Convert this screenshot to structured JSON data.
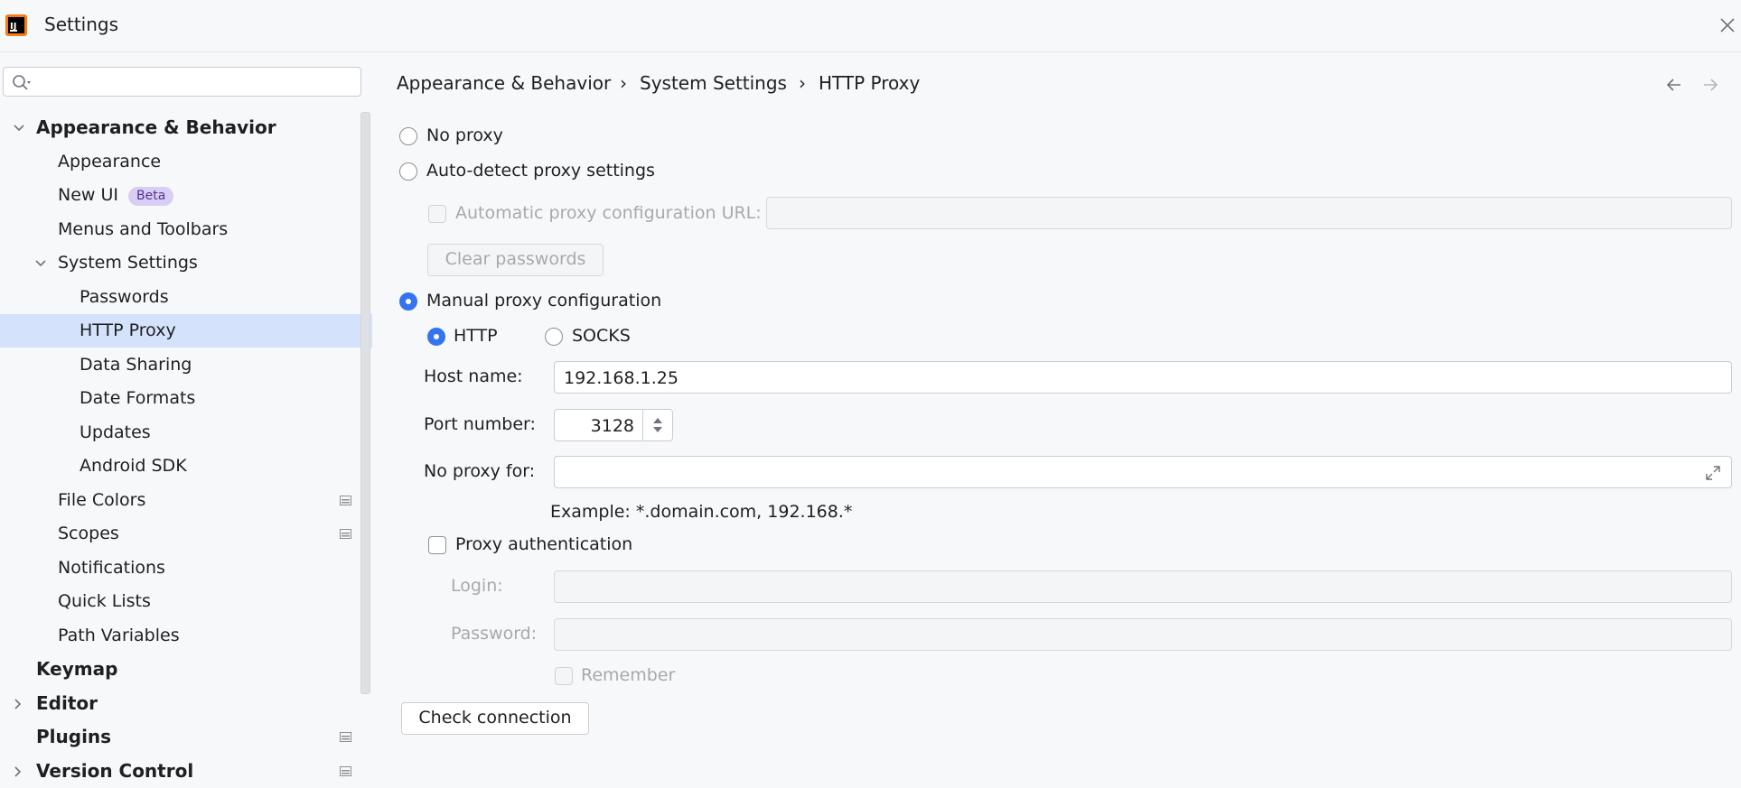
{
  "window": {
    "title": "Settings",
    "app_icon": "intellij-app-icon",
    "close_icon": "close-icon"
  },
  "search": {
    "placeholder": "",
    "value": ""
  },
  "sidebar": {
    "items": [
      {
        "label": "Appearance & Behavior",
        "expanded": true
      },
      {
        "label": "Appearance"
      },
      {
        "label": "New UI",
        "badge": "Beta"
      },
      {
        "label": "Menus and Toolbars"
      },
      {
        "label": "System Settings",
        "expanded": true
      },
      {
        "label": "Passwords"
      },
      {
        "label": "HTTP Proxy",
        "selected": true
      },
      {
        "label": "Data Sharing"
      },
      {
        "label": "Date Formats"
      },
      {
        "label": "Updates"
      },
      {
        "label": "Android SDK"
      },
      {
        "label": "File Colors",
        "project_level": true
      },
      {
        "label": "Scopes",
        "project_level": true
      },
      {
        "label": "Notifications"
      },
      {
        "label": "Quick Lists"
      },
      {
        "label": "Path Variables"
      },
      {
        "label": "Keymap"
      },
      {
        "label": "Editor",
        "expanded": false
      },
      {
        "label": "Plugins",
        "project_level": true
      },
      {
        "label": "Version Control",
        "expanded": false,
        "project_level": true
      }
    ]
  },
  "breadcrumb": [
    "Appearance & Behavior",
    "System Settings",
    "HTTP Proxy"
  ],
  "breadcrumb_separator": "›",
  "proxy": {
    "no_proxy_label": "No proxy",
    "auto_detect_label": "Auto-detect proxy settings",
    "auto_config_url_label": "Automatic proxy configuration URL:",
    "auto_config_url_value": "",
    "clear_passwords_label": "Clear passwords",
    "manual_label": "Manual proxy configuration",
    "selected_mode": "Manual proxy configuration",
    "http_label": "HTTP",
    "socks_label": "SOCKS",
    "selected_protocol": "HTTP",
    "host_label": "Host name:",
    "host_value": "192.168.1.25",
    "port_label": "Port number:",
    "port_value": "3128",
    "no_proxy_for_label": "No proxy for:",
    "no_proxy_for_value": "",
    "example_text": "Example: *.domain.com, 192.168.*",
    "auth_label": "Proxy authentication",
    "auth_checked": false,
    "login_label": "Login:",
    "login_value": "",
    "password_label": "Password:",
    "password_value": "",
    "remember_label": "Remember",
    "check_connection_label": "Check connection"
  },
  "colors": {
    "accent": "#3574f0",
    "selection": "#d4e2fb",
    "badge_bg": "#d8cdf5",
    "badge_text": "#55338f",
    "background": "#f7f8fa"
  }
}
